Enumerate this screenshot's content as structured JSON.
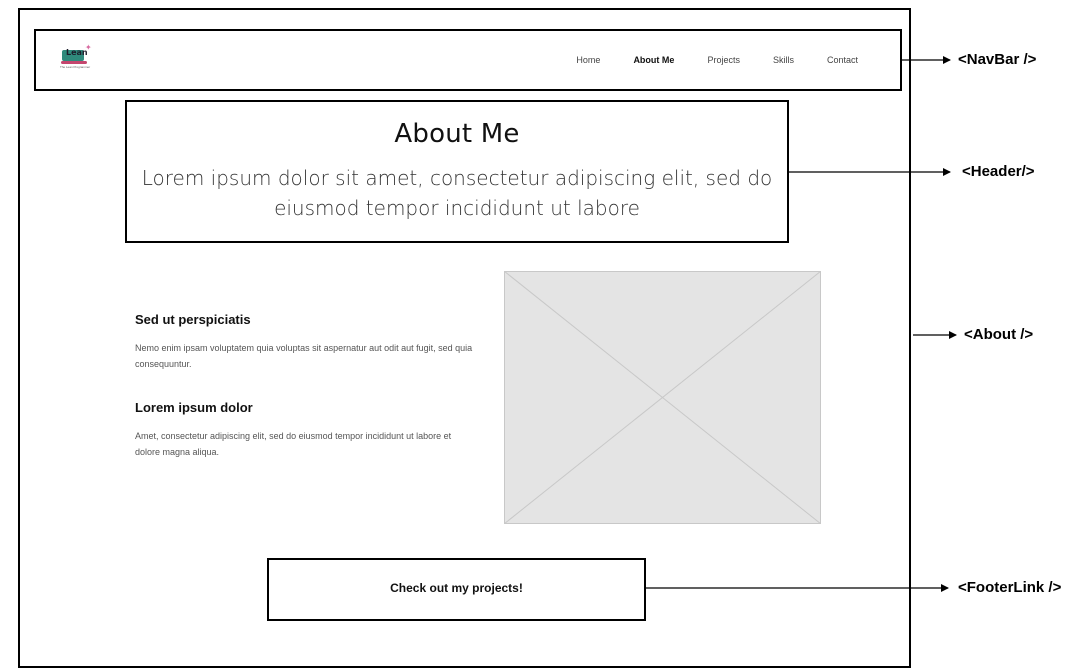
{
  "navbar": {
    "logo_text": "Lean",
    "logo_tagline": "The Lean Programmer",
    "links": [
      "Home",
      "About Me",
      "Projects",
      "Skills",
      "Contact"
    ],
    "active_index": 1
  },
  "header": {
    "title": "About Me",
    "subtitle": "Lorem ipsum dolor sit amet, consectetur adipiscing elit, sed do eiusmod tempor incididunt ut labore"
  },
  "about": {
    "sections": [
      {
        "heading": "Sed ut perspiciatis",
        "body": "Nemo enim ipsam voluptatem quia voluptas sit aspernatur aut odit aut fugit, sed quia consequuntur."
      },
      {
        "heading": "Lorem ipsum dolor",
        "body": "Amet, consectetur adipiscing elit, sed do eiusmod tempor incididunt ut labore et dolore magna aliqua."
      }
    ]
  },
  "footer_link": {
    "label": "Check out my projects!"
  },
  "annotations": {
    "navbar": "<NavBar />",
    "header": "<Header/>",
    "about": "<About />",
    "footer_link": "<FooterLink />"
  },
  "colors": {
    "stroke": "#000000",
    "placeholder_fill": "#e4e4e4",
    "placeholder_line": "#c8c8c8",
    "logo_teal": "#2f8a7c",
    "logo_pink": "#c4466e"
  }
}
